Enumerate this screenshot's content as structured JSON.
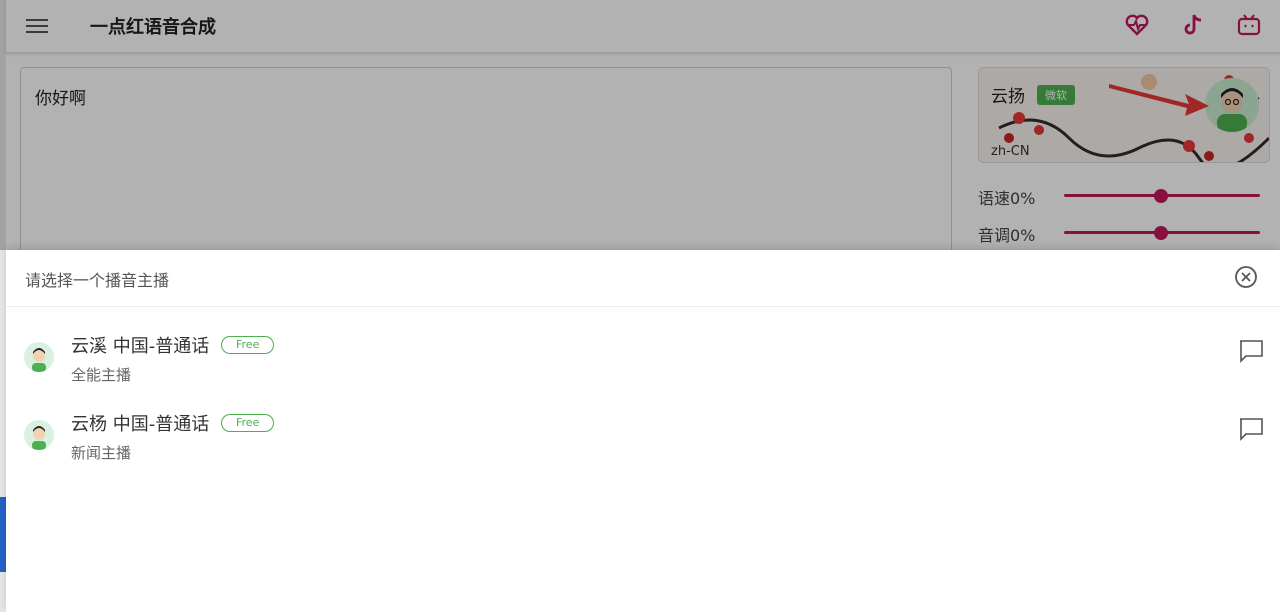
{
  "app": {
    "title": "一点红语音合成",
    "top_icons": [
      "heart-pulse-icon",
      "tiktok-icon",
      "bilibili-icon"
    ],
    "accent_color": "#c2185b"
  },
  "editor": {
    "text": "你好啊"
  },
  "current_voice": {
    "name": "云扬",
    "tag": "微软",
    "locale": "zh-CN"
  },
  "sliders": [
    {
      "label": "语速0%",
      "value_percent": 0
    },
    {
      "label": "音调0%",
      "value_percent": 0
    }
  ],
  "sheet": {
    "title": "请选择一个播音主播",
    "items": [
      {
        "name": "云溪 中国-普通话",
        "badge": "Free",
        "subtitle": "全能主播"
      },
      {
        "name": "云杨 中国-普通话",
        "badge": "Free",
        "subtitle": "新闻主播"
      }
    ]
  }
}
